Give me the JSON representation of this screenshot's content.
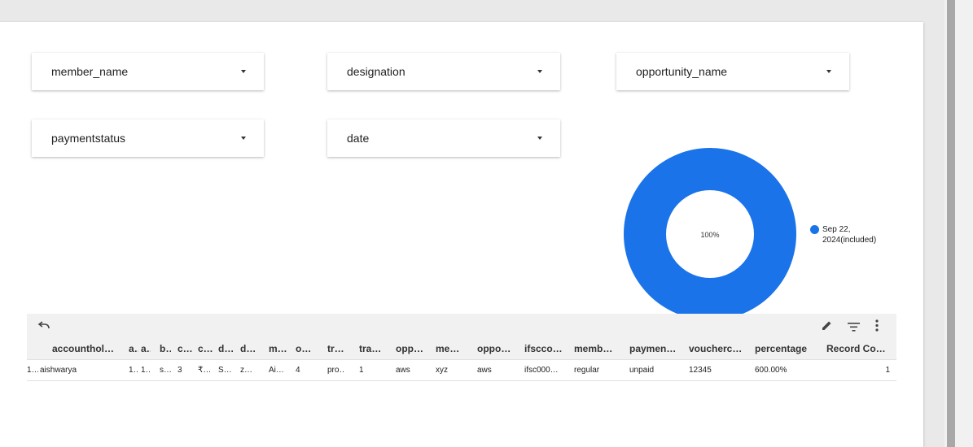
{
  "filters": [
    {
      "label": "member_name"
    },
    {
      "label": "designation"
    },
    {
      "label": "opportunity_name"
    },
    {
      "label": "paymentstatus"
    },
    {
      "label": "date"
    }
  ],
  "donut": {
    "center_label": "100%",
    "color": "#1a73e8",
    "legend": {
      "line1": "Sep 22,",
      "line2": "2024(included)"
    }
  },
  "chart_data": {
    "type": "pie",
    "categories": [
      "Sep 22, 2024(included)"
    ],
    "values": [
      100
    ],
    "colors": [
      "#1a73e8"
    ]
  },
  "toolbar": {
    "icons": [
      "undo-icon",
      "edit-icon",
      "filter-icon",
      "more-vert-icon"
    ]
  },
  "table": {
    "headers": [
      "accounthol…",
      "a…",
      "a…",
      "b…",
      "c…",
      "c…",
      "d…",
      "d…",
      "m…",
      "o…",
      "tr…",
      "tra…",
      "opp…",
      "me…",
      "oppo…",
      "ifscco…",
      "memb…",
      "paymen…",
      "voucherc…",
      "percentage",
      "Record Co…"
    ],
    "rows": [
      [
        "1…",
        "aishwarya",
        "1…",
        "1…",
        "s…",
        "3",
        "₹…",
        "S…",
        "z…",
        "Ai…",
        "4",
        "pro…",
        "1",
        "aws",
        "xyz",
        "aws",
        "ifsc000…",
        "regular",
        "unpaid",
        "12345",
        "600.00%",
        "1"
      ]
    ]
  }
}
